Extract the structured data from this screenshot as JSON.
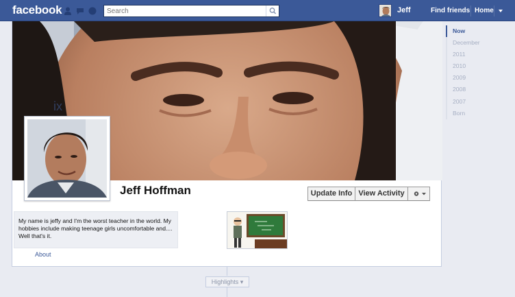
{
  "topbar": {
    "logo": "facebook",
    "search": {
      "placeholder": "Search"
    },
    "user_name": "Jeff",
    "find_friends": "Find friends",
    "home": "Home"
  },
  "profile": {
    "name": "Jeff Hoffman",
    "buttons": {
      "update_info": "Update Info",
      "view_activity": "View Activity"
    },
    "bio": "My name is jeffy and I'm the worst teacher in the world. My hobbies include making teenage girls uncomfortable and.... Well that's it.",
    "about": "About"
  },
  "timeline": {
    "highlights": "Highlights"
  },
  "scrubber": {
    "items": [
      "Now",
      "December",
      "2011",
      "2010",
      "2009",
      "2008",
      "2007",
      "Born"
    ]
  },
  "colors": {
    "brand_blue": "#3b5998",
    "page_bg": "#e9ebf2"
  }
}
